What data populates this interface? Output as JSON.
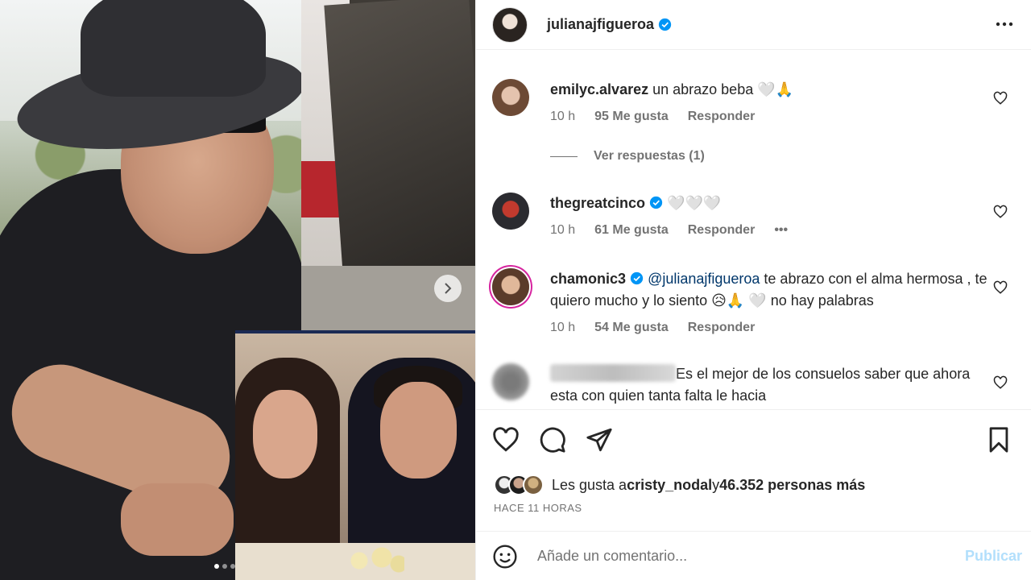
{
  "post": {
    "author": "julianajfigueroa",
    "verified": true
  },
  "media": {
    "carousel_dots": 3,
    "active_dot": 0
  },
  "comments": [
    {
      "username": "emilyc.alvarez",
      "verified": false,
      "text": "un abrazo beba 🤍🙏",
      "time": "10 h",
      "likes": "95 Me gusta",
      "reply_label": "Responder"
    },
    {
      "username": "thegreatcinco",
      "verified": true,
      "text": "🤍🤍🤍",
      "time": "10 h",
      "likes": "61 Me gusta",
      "reply_label": "Responder",
      "more": "•••"
    },
    {
      "username": "chamonic3",
      "verified": true,
      "mention": "@julianajfigueroa",
      "text": " te abrazo con el alma hermosa , te quiero mucho y lo siento 😥🙏 🤍 no hay palabras",
      "time": "10 h",
      "likes": "54 Me gusta",
      "reply_label": "Responder"
    },
    {
      "username": "",
      "verified": false,
      "text": "Es el mejor de los consuelos saber que ahora esta con quien tanta falta le hacia"
    }
  ],
  "view_replies": "Ver respuestas (1)",
  "likes_summary": {
    "prefix": "Les gusta a ",
    "user": "cristy_nodal",
    "middle": " y ",
    "count": "46.352 personas más"
  },
  "time_ago": "HACE 11 HORAS",
  "add_comment": {
    "placeholder": "Añade un comentario...",
    "publish_label": "Publicar"
  },
  "colors": {
    "verified_blue": "#0095f6",
    "publish_disabled": "#b2dffc",
    "mention": "#00376b",
    "secondary_text": "#737373"
  },
  "icons": [
    "next-arrow-icon",
    "more-options-icon",
    "verified-icon",
    "heart-icon",
    "comment-icon",
    "share-icon",
    "save-icon",
    "emoji-icon"
  ]
}
